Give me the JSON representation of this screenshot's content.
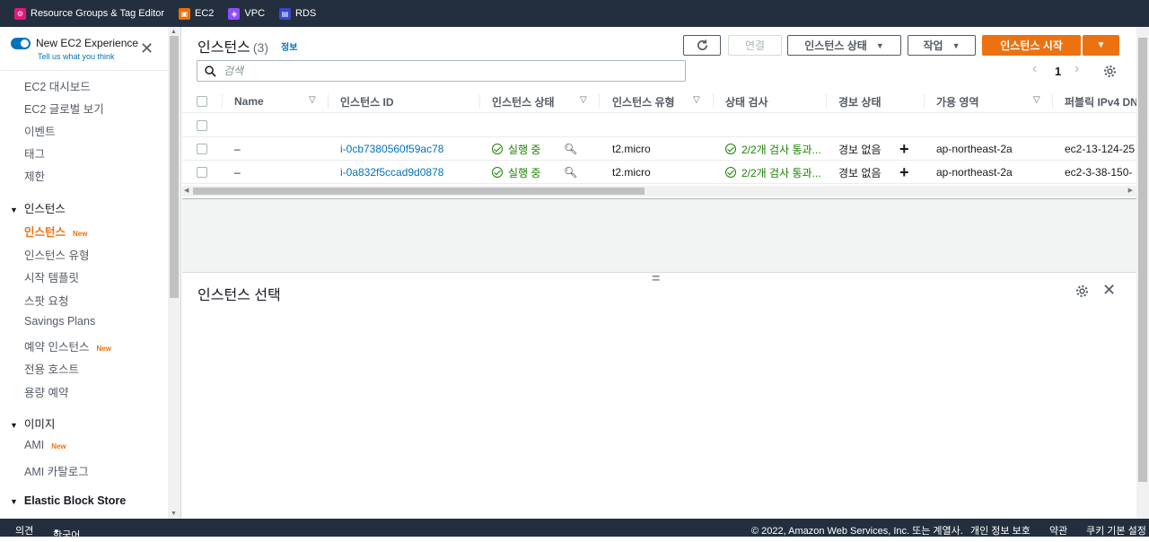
{
  "topbar": {
    "favorites": [
      {
        "label": "Resource Groups & Tag Editor",
        "color": "#e7157b",
        "icon": "resource-groups-icon"
      },
      {
        "label": "EC2",
        "color": "#ed7100",
        "icon": "ec2-icon"
      },
      {
        "label": "VPC",
        "color": "#8c4fff",
        "icon": "vpc-icon"
      },
      {
        "label": "RDS",
        "color": "#3b48cc",
        "icon": "rds-icon"
      }
    ]
  },
  "sidebar": {
    "new_experience_title": "New EC2 Experience",
    "new_experience_sub": "Tell us what you think",
    "items_top": [
      "EC2 대시보드",
      "EC2 글로벌 보기",
      "이벤트",
      "태그",
      "제한"
    ],
    "section_instances": "인스턴스",
    "instances_items": [
      {
        "label": "인스턴스",
        "badge": "New"
      },
      {
        "label": "인스턴스 유형",
        "badge": ""
      },
      {
        "label": "시작 템플릿",
        "badge": ""
      },
      {
        "label": "스팟 요청",
        "badge": ""
      },
      {
        "label": "Savings Plans",
        "badge": ""
      },
      {
        "label": "예약 인스턴스",
        "badge": "New"
      },
      {
        "label": "전용 호스트",
        "badge": ""
      },
      {
        "label": "용량 예약",
        "badge": ""
      }
    ],
    "section_images": "이미지",
    "images_items": [
      {
        "label": "AMI",
        "badge": "New"
      },
      {
        "label": "AMI 카탈로그",
        "badge": ""
      }
    ],
    "section_ebs": "Elastic Block Store"
  },
  "main": {
    "title": "인스턴스",
    "count": "(3)",
    "info": "정보",
    "buttons": {
      "connect": "연결",
      "instance_state": "인스턴스 상태",
      "actions": "작업",
      "launch": "인스턴스 시작"
    },
    "search_placeholder": "검색",
    "page": "1",
    "columns": [
      "Name",
      "인스턴스 ID",
      "인스턴스 상태",
      "인스턴스 유형",
      "상태 검사",
      "경보 상태",
      "가용 영역",
      "퍼블릭 IPv4 DN"
    ],
    "rows": [
      {
        "name": "–",
        "id": "i-0cb7380560f59ac78",
        "state": "실행 중",
        "type": "t2.micro",
        "check": "2/2개 검사 통과...",
        "alarm": "경보 없음",
        "az": "ap-northeast-2a",
        "dns": "ec2-13-124-25"
      },
      {
        "name": "–",
        "id": "i-0a832f5ccad9d0878",
        "state": "실행 중",
        "type": "t2.micro",
        "check": "2/2개 검사 통과...",
        "alarm": "경보 없음",
        "az": "ap-northeast-2a",
        "dns": "ec2-3-38-150-"
      }
    ],
    "detail_title": "인스턴스 선택"
  },
  "footer": {
    "feedback": "의견",
    "language": "한국어",
    "copyright": "© 2022, Amazon Web Services, Inc. 또는 계열사.",
    "privacy": "개인 정보 보호",
    "terms": "약관",
    "cookies": "쿠키 기본 설정"
  }
}
